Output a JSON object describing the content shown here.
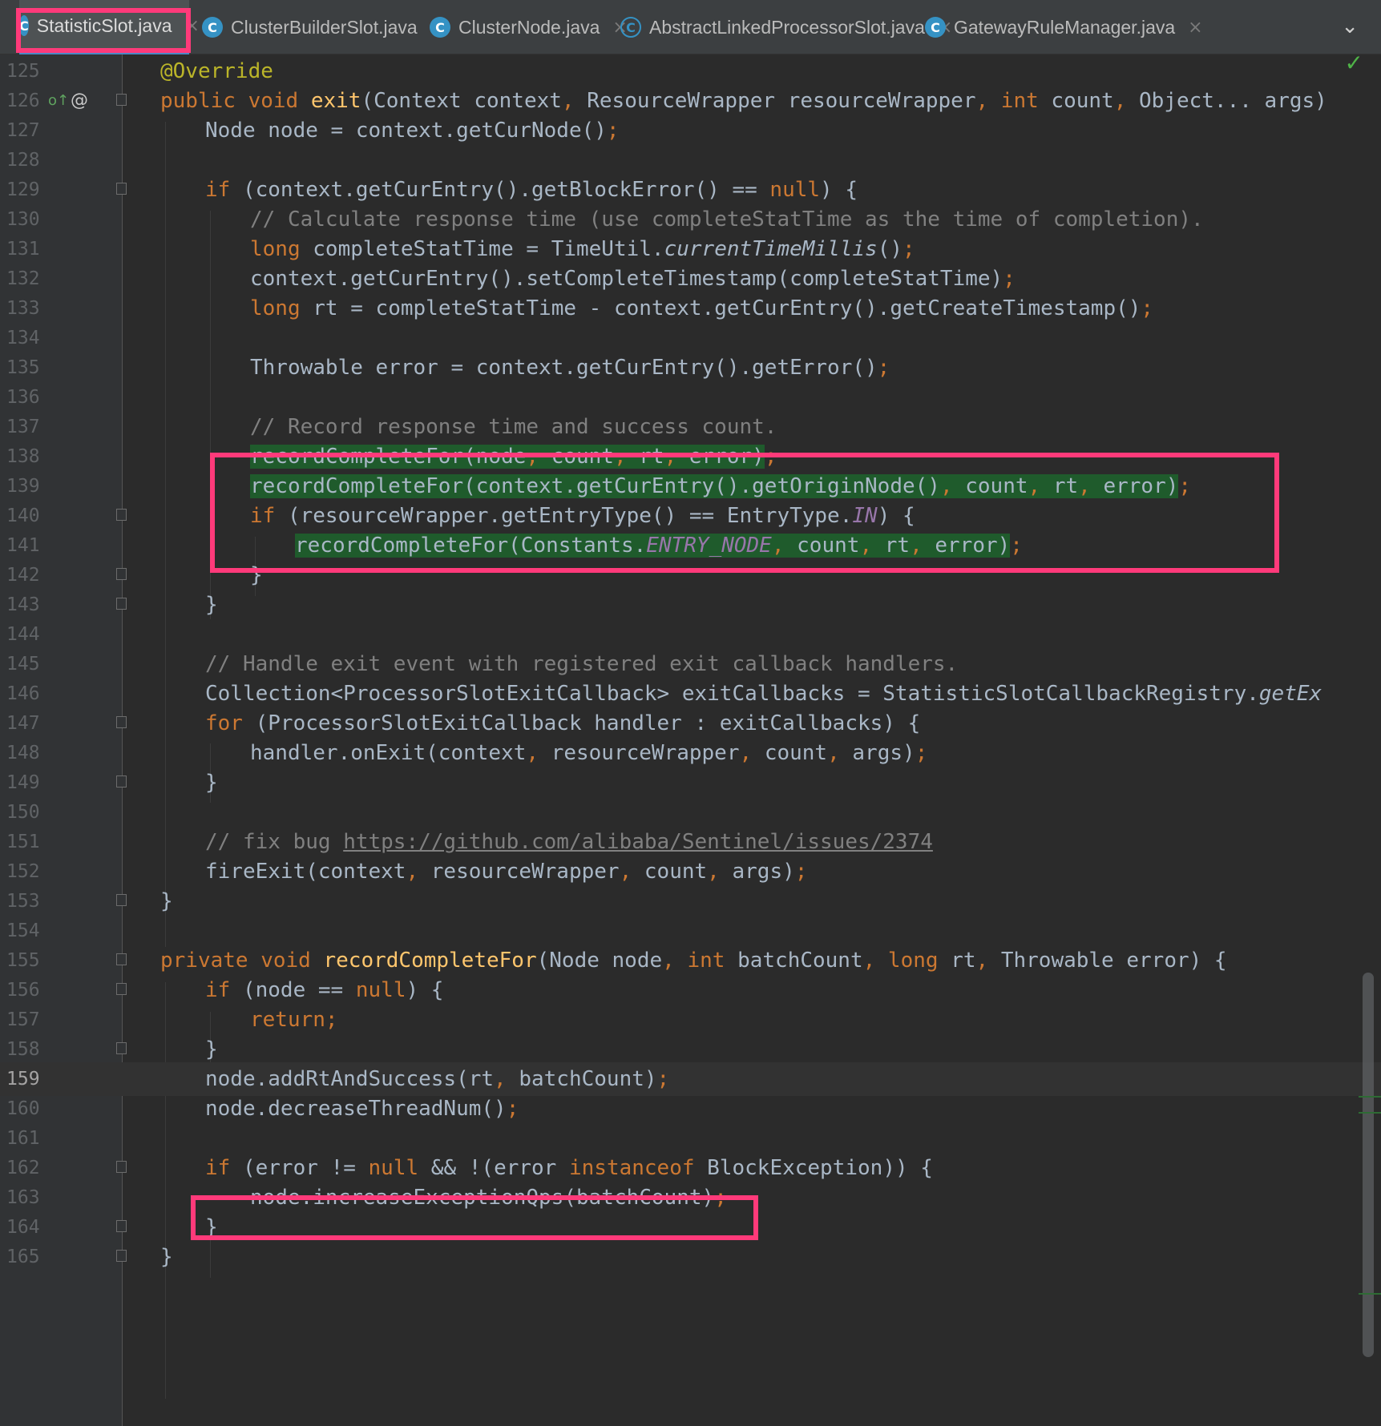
{
  "tabs": [
    {
      "label": "StatisticSlot.java",
      "active": true,
      "icon": "class-icon"
    },
    {
      "label": "ClusterBuilderSlot.java",
      "active": false,
      "icon": "class-icon"
    },
    {
      "label": "ClusterNode.java",
      "active": false,
      "icon": "class-icon"
    },
    {
      "label": "AbstractLinkedProcessorSlot.java",
      "active": false,
      "icon": "abstract-class-icon"
    },
    {
      "label": "GatewayRuleManager.java",
      "active": false,
      "icon": "class-icon"
    }
  ],
  "icons": {
    "close": "×",
    "chevron": "⌄",
    "check": "✓",
    "class_letter": "C",
    "override": "o↑",
    "at": "@"
  },
  "editor": {
    "current_line": "159",
    "lines": [
      {
        "n": "125",
        "text": "@Override"
      },
      {
        "n": "126",
        "text": "public void exit(Context context, ResourceWrapper resourceWrapper, int count, Object... args)"
      },
      {
        "n": "127",
        "text": "Node node = context.getCurNode();"
      },
      {
        "n": "128",
        "text": ""
      },
      {
        "n": "129",
        "text": "if (context.getCurEntry().getBlockError() == null) {"
      },
      {
        "n": "130",
        "text": "// Calculate response time (use completeStatTime as the time of completion)."
      },
      {
        "n": "131",
        "text": "long completeStatTime = TimeUtil.currentTimeMillis();"
      },
      {
        "n": "132",
        "text": "context.getCurEntry().setCompleteTimestamp(completeStatTime);"
      },
      {
        "n": "133",
        "text": "long rt = completeStatTime - context.getCurEntry().getCreateTimestamp();"
      },
      {
        "n": "134",
        "text": ""
      },
      {
        "n": "135",
        "text": "Throwable error = context.getCurEntry().getError();"
      },
      {
        "n": "136",
        "text": ""
      },
      {
        "n": "137",
        "text": "// Record response time and success count."
      },
      {
        "n": "138",
        "text": "recordCompleteFor(node, count, rt, error);"
      },
      {
        "n": "139",
        "text": "recordCompleteFor(context.getCurEntry().getOriginNode(), count, rt, error);"
      },
      {
        "n": "140",
        "text": "if (resourceWrapper.getEntryType() == EntryType.IN) {"
      },
      {
        "n": "141",
        "text": "recordCompleteFor(Constants.ENTRY_NODE, count, rt, error);"
      },
      {
        "n": "142",
        "text": "}"
      },
      {
        "n": "143",
        "text": "}"
      },
      {
        "n": "144",
        "text": ""
      },
      {
        "n": "145",
        "text": "// Handle exit event with registered exit callback handlers."
      },
      {
        "n": "146",
        "text": "Collection<ProcessorSlotExitCallback> exitCallbacks = StatisticSlotCallbackRegistry.getEx"
      },
      {
        "n": "147",
        "text": "for (ProcessorSlotExitCallback handler : exitCallbacks) {"
      },
      {
        "n": "148",
        "text": "handler.onExit(context, resourceWrapper, count, args);"
      },
      {
        "n": "149",
        "text": "}"
      },
      {
        "n": "150",
        "text": ""
      },
      {
        "n": "151",
        "text": "// fix bug https://github.com/alibaba/Sentinel/issues/2374"
      },
      {
        "n": "152",
        "text": "fireExit(context, resourceWrapper, count, args);"
      },
      {
        "n": "153",
        "text": "}"
      },
      {
        "n": "154",
        "text": ""
      },
      {
        "n": "155",
        "text": "private void recordCompleteFor(Node node, int batchCount, long rt, Throwable error) {"
      },
      {
        "n": "156",
        "text": "if (node == null) {"
      },
      {
        "n": "157",
        "text": "return;"
      },
      {
        "n": "158",
        "text": "}"
      },
      {
        "n": "159",
        "text": "node.addRtAndSuccess(rt, batchCount);"
      },
      {
        "n": "160",
        "text": "node.decreaseThreadNum();"
      },
      {
        "n": "161",
        "text": ""
      },
      {
        "n": "162",
        "text": "if (error != null && !(error instanceof BlockException)) {"
      },
      {
        "n": "163",
        "text": "node.increaseExceptionQps(batchCount);"
      },
      {
        "n": "164",
        "text": "}"
      },
      {
        "n": "165",
        "text": "}"
      }
    ]
  },
  "colors": {
    "highlight_box": "#ff3a7a",
    "usage_highlight": "#1f5b2c",
    "keyword": "#cc7832",
    "method": "#ffc66d",
    "comment": "#808080"
  }
}
